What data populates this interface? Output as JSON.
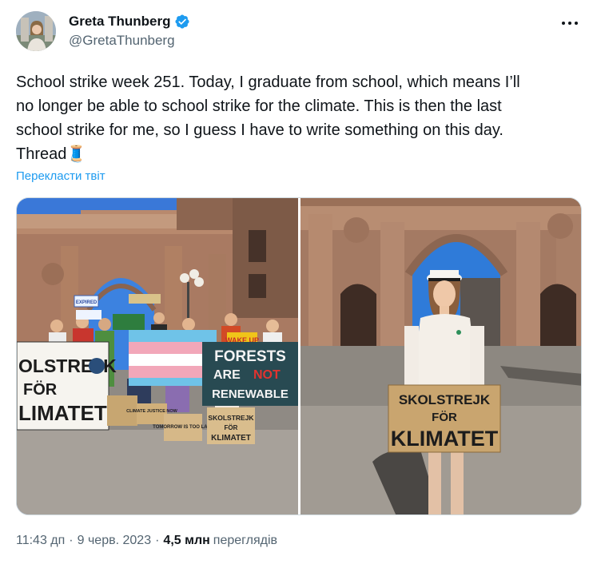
{
  "author": {
    "display_name": "Greta Thunberg",
    "handle": "@GretaThunberg",
    "verified": true
  },
  "tweet": {
    "text_line1": "School strike week 251. Today, I graduate from school, which means I’ll",
    "text_line2": "no longer be able to school strike for the climate. This is then the last",
    "text_line3": "school strike for me, so I guess I have to write something on this day.",
    "text_line4": "Thread",
    "text_emoji": "🧵",
    "translate_link": "Перекласти твіт"
  },
  "media": {
    "photo1": {
      "signs": {
        "skolstrejk_left_1": "OLSTREJK",
        "skolstrejk_left_2": "FÖR",
        "skolstrejk_left_3": "LIMATET",
        "forests_1": "FORESTS",
        "forests_2a": "ARE ",
        "forests_2b": "NOT",
        "forests_3": "RENEWABLE",
        "wake_up": "WAKE UP",
        "climate_justice": "CLIMATE JUSTICE NOW",
        "tomorrow": "TOMORROW IS TOO LATE",
        "small_skol_1": "SKOLSTREJK",
        "small_skol_2": "FÖR",
        "small_skol_3": "KLIMATET",
        "expired": "EXPIRED"
      }
    },
    "photo2": {
      "sign_1": "SKOLSTREJK",
      "sign_2": "FÖR",
      "sign_3": "KLIMATET"
    }
  },
  "meta": {
    "time": "11:43 дп",
    "date": "9 черв. 2023",
    "views_count": "4,5 млн",
    "views_label": "переглядів",
    "separator": "·"
  },
  "colors": {
    "link": "#1d9bf0",
    "secondary_text": "#536471",
    "verified_badge": "#1d9bf0"
  },
  "icons": {
    "verified": "verified-badge-icon",
    "more": "more-dots-icon"
  }
}
